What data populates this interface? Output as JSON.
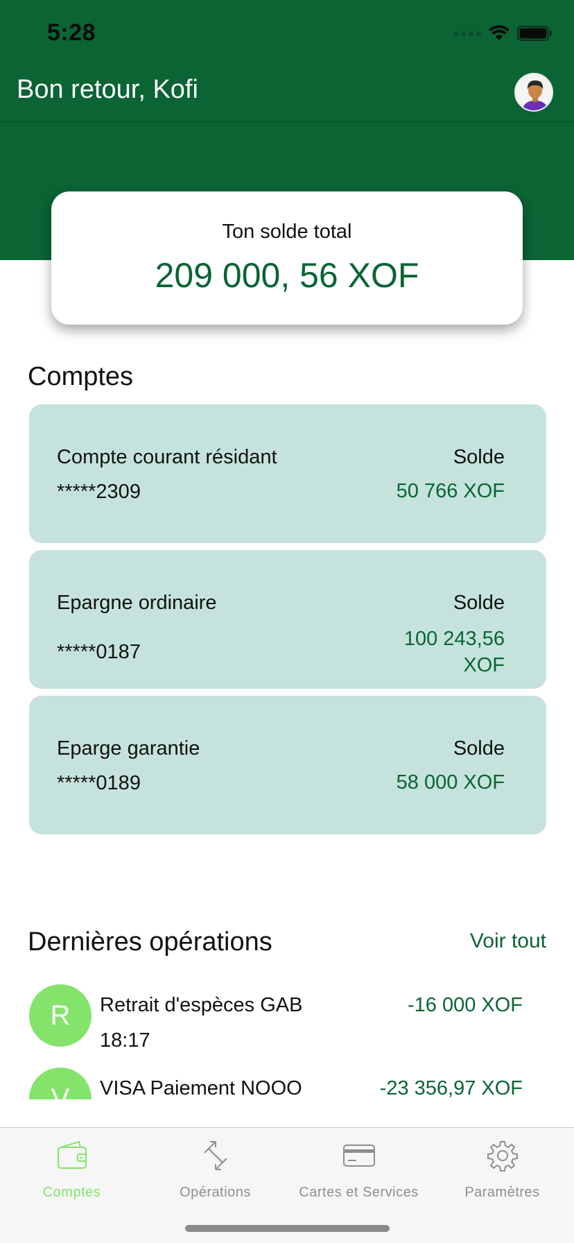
{
  "status_bar": {
    "time": "5:28"
  },
  "header": {
    "greeting": "Bon retour, Kofi"
  },
  "balance": {
    "label": "Ton solde total",
    "value": "209 000, 56 XOF"
  },
  "accounts_section": {
    "title": "Comptes"
  },
  "accounts": [
    {
      "name": "Compte courant résidant",
      "number": "*****2309",
      "solde_label": "Solde",
      "amount": "50 766 XOF"
    },
    {
      "name": "Epargne ordinaire",
      "number": "*****0187",
      "solde_label": "Solde",
      "amount": "100 243,56\nXOF"
    },
    {
      "name": "Eparge garantie",
      "number": "*****0189",
      "solde_label": "Solde",
      "amount": "58 000 XOF"
    }
  ],
  "operations_section": {
    "title": "Dernières opérations",
    "see_all": "Voir tout"
  },
  "operations": [
    {
      "initial": "R",
      "title": "Retrait d'espèces GAB",
      "time": "18:17",
      "amount": "-16 000 XOF"
    },
    {
      "initial": "V",
      "title": "VISA Paiement NOOO",
      "amount": "-23 356,97 XOF"
    }
  ],
  "tabs": [
    {
      "label": "Comptes",
      "icon": "wallet-icon",
      "active": true
    },
    {
      "label": "Opérations",
      "icon": "transfer-arrows-icon",
      "active": false
    },
    {
      "label": "Cartes et Services",
      "icon": "card-icon",
      "active": false
    },
    {
      "label": "Paramètres",
      "icon": "gear-icon",
      "active": false
    }
  ],
  "colors": {
    "brand_green": "#0a6434",
    "card_mint": "#c5e3dc",
    "accent_light_green": "#84e36b",
    "inactive_gray": "#8e8e8e"
  }
}
